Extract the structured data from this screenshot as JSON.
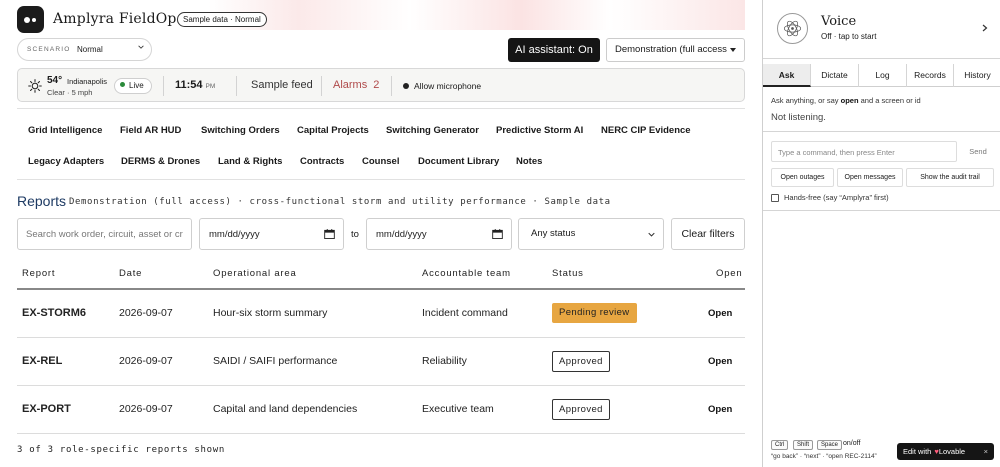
{
  "header": {
    "brand": "Amplyra  FieldOps Pro",
    "sample_pill": "Sample data · Normal",
    "scenario_label": "SCENARIO",
    "scenario_value": "Normal",
    "ai_button": "AI assistant: On",
    "access_select": "Demonstration (full access)"
  },
  "status_bar": {
    "temperature": "54°",
    "city": "Indianapolis",
    "weather": "Clear · 5 mph",
    "live": "Live",
    "time": "11:54",
    "ampm": "PM",
    "feed": "Sample feed",
    "alarms_label": "Alarms",
    "alarms_count": "2",
    "mic": "Allow microphone"
  },
  "nav_row1": [
    "Grid Intelligence",
    "Field AR HUD",
    "Switching Orders",
    "Capital Projects",
    "Switching Generator",
    "Predictive Storm AI",
    "NERC CIP Evidence"
  ],
  "nav_row2": [
    "Legacy Adapters",
    "DERMS & Drones",
    "Land & Rights",
    "Contracts",
    "Counsel",
    "Document Library",
    "Notes"
  ],
  "reports": {
    "title": "Reports",
    "subtitle": "Demonstration (full access) · cross-functional storm and utility performance · Sample data",
    "filters": {
      "search_placeholder": "Search work order, circuit, asset or crew",
      "date_from": "mm/dd/yyyy",
      "to": "to",
      "date_to": "mm/dd/yyyy",
      "status": "Any status",
      "clear": "Clear filters"
    },
    "columns": [
      "Report",
      "Date",
      "Operational area",
      "Accountable team",
      "Status",
      "Open"
    ],
    "rows": [
      {
        "id": "EX-STORM6",
        "date": "2026-09-07",
        "area": "Hour-six storm summary",
        "team": "Incident command",
        "status": "Pending review",
        "status_kind": "pending",
        "open": "Open"
      },
      {
        "id": "EX-REL",
        "date": "2026-09-07",
        "area": "SAIDI / SAIFI performance",
        "team": "Reliability",
        "status": "Approved",
        "status_kind": "approved",
        "open": "Open"
      },
      {
        "id": "EX-PORT",
        "date": "2026-09-07",
        "area": "Capital and land dependencies",
        "team": "Executive team",
        "status": "Approved",
        "status_kind": "approved",
        "open": "Open"
      }
    ],
    "footer": "3 of 3 role-specific reports shown"
  },
  "voice": {
    "title": "Voice",
    "subtitle": "Off · tap to start",
    "tabs": [
      "Ask",
      "Dictate",
      "Log",
      "Records",
      "History"
    ],
    "hint_pre": "Ask anything, or say ",
    "hint_bold": "open",
    "hint_post": " and a screen or id",
    "status": "Not listening.",
    "input_placeholder": "Type a command, then press Enter",
    "send": "Send",
    "quick_buttons": [
      "Open outages",
      "Open messages",
      "Show the audit trail"
    ],
    "handsfree": "Hands-free (say “Amplyra” first)",
    "keys": [
      "Ctrl",
      "Shift",
      "Space"
    ],
    "keys_label": "on/off",
    "commands": "“go back” · “next” · “open REC-2114”",
    "lovable": "Edit with",
    "lovable_brand": "Lovable"
  },
  "colors": {
    "accent_dark": "#151515",
    "pending": "#e7a641",
    "alarm": "#b04a4a",
    "reports_title": "#1d3a63",
    "live_dot": "#2a8a3a"
  }
}
